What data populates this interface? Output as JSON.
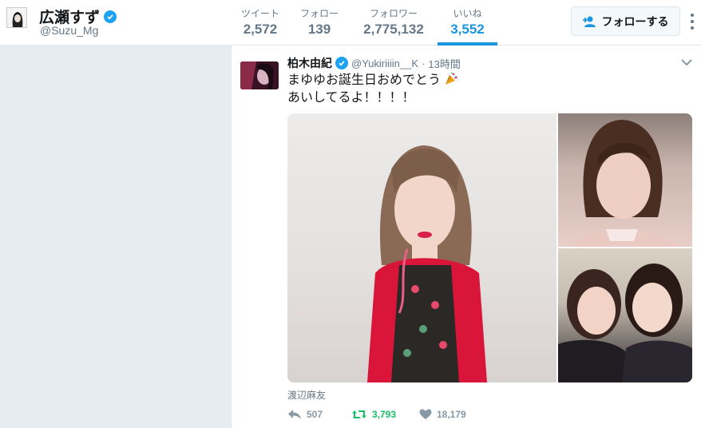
{
  "profile": {
    "name": "広瀬すず",
    "handle": "@Suzu_Mg"
  },
  "stats": [
    {
      "label": "ツイート",
      "value": "2,572"
    },
    {
      "label": "フォロー",
      "value": "139"
    },
    {
      "label": "フォロワー",
      "value": "2,775,132"
    },
    {
      "label": "いいね",
      "value": "3,552"
    }
  ],
  "actions": {
    "follow_label": "フォローする"
  },
  "tweet": {
    "author_name": "柏木由紀",
    "author_handle": "@Yukiriiiin__K",
    "time": "13時間",
    "text_line1": "まゆゆお誕生日おめでとう",
    "text_line2": "あいしてるよ！！！！",
    "caption": "渡辺麻友",
    "reply_count": "507",
    "retweet_count": "3,793",
    "like_count": "18,179"
  },
  "colors": {
    "accent": "#1b95e0",
    "verified": "#1da1f2",
    "retweet": "#17bf63",
    "muted": "#657786"
  }
}
